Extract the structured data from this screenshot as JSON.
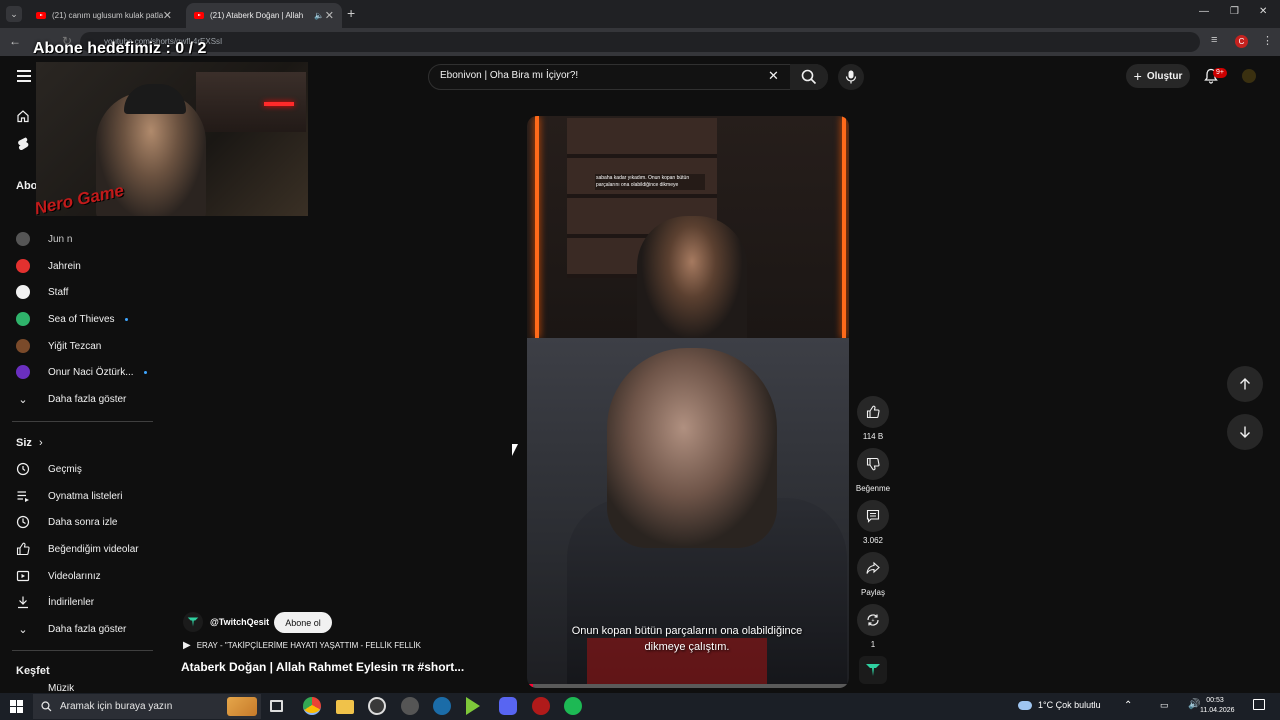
{
  "browser": {
    "tabs": [
      {
        "label": "(21) canım uglusum kulak patla"
      },
      {
        "label": "(21) Ataberk Doğan | Allah"
      }
    ],
    "url": "youtube.com/shorts/gwfL4rEXSsI"
  },
  "overlay": {
    "goal_text": "Abone hedefimiz : 0 / 2",
    "logo_text": "Nero Game"
  },
  "header": {
    "search_query": "Ebonivon | Oha Bira mı İçiyor?!",
    "create_label": "Oluştur",
    "notifications_badge": "9+"
  },
  "sidebar": {
    "subscriptions_title": "Abo",
    "channels": [
      {
        "label": "Jahrein",
        "color": "#e3312f"
      },
      {
        "label": "Staff",
        "color": "#f1f1f1"
      },
      {
        "label": "Sea of Thieves",
        "color": "#2fb36b",
        "new": true
      },
      {
        "label": "Yiğit Tezcan",
        "color": "#7a4a2a"
      },
      {
        "label": "Onur Naci Öztürk...",
        "color": "#6a2fc0",
        "new": true
      }
    ],
    "channels_partial": "Jun  n",
    "show_more_1": "Daha fazla göster",
    "you_title": "Siz",
    "you_items": [
      {
        "label": "Geçmiş",
        "icon": "history-icon"
      },
      {
        "label": "Oynatma listeleri",
        "icon": "playlist-icon"
      },
      {
        "label": "Daha sonra izle",
        "icon": "watch-later-icon"
      },
      {
        "label": "Beğendiğim videolar",
        "icon": "like-icon"
      },
      {
        "label": "Videolarınız",
        "icon": "video-icon"
      },
      {
        "label": "İndirilenler",
        "icon": "download-icon"
      }
    ],
    "show_more_2": "Daha fazla göster",
    "explore_title": "Keşfet",
    "explore_partial": "Müzik"
  },
  "video": {
    "small_caption": "sabaha kadar yıkadım. Onun kopan bütün parçalarını ona olabildiğince dikmeye",
    "subtitle": "Onun kopan bütün parçalarını ona olabildiğince dikmeye çalıştım.",
    "progress": 0.02
  },
  "actions": {
    "likes": "114 B",
    "dislike_label": "Beğenme",
    "comments": "3.062",
    "share_label": "Paylaş",
    "remix_count": "1"
  },
  "info": {
    "channel": "@TwitchQesit",
    "subscribe_label": "Abone ol",
    "music": "ERAY - \"TAKİPÇİLERİME HAYATI YAŞATTIM - FELLİK FELLİK",
    "title": "Ataberk Doğan | Allah Rahmet Eylesin ᴛʀ #short..."
  },
  "taskbar": {
    "search_placeholder": "Aramak için buraya yazın",
    "weather": "1°C  Çok bulutlu",
    "time": "00:53",
    "date": "11.04.2026"
  },
  "colors": {
    "accent_red": "#ff0033",
    "yt_bg": "#0f0f0f",
    "link_blue": "#3ea6ff"
  }
}
